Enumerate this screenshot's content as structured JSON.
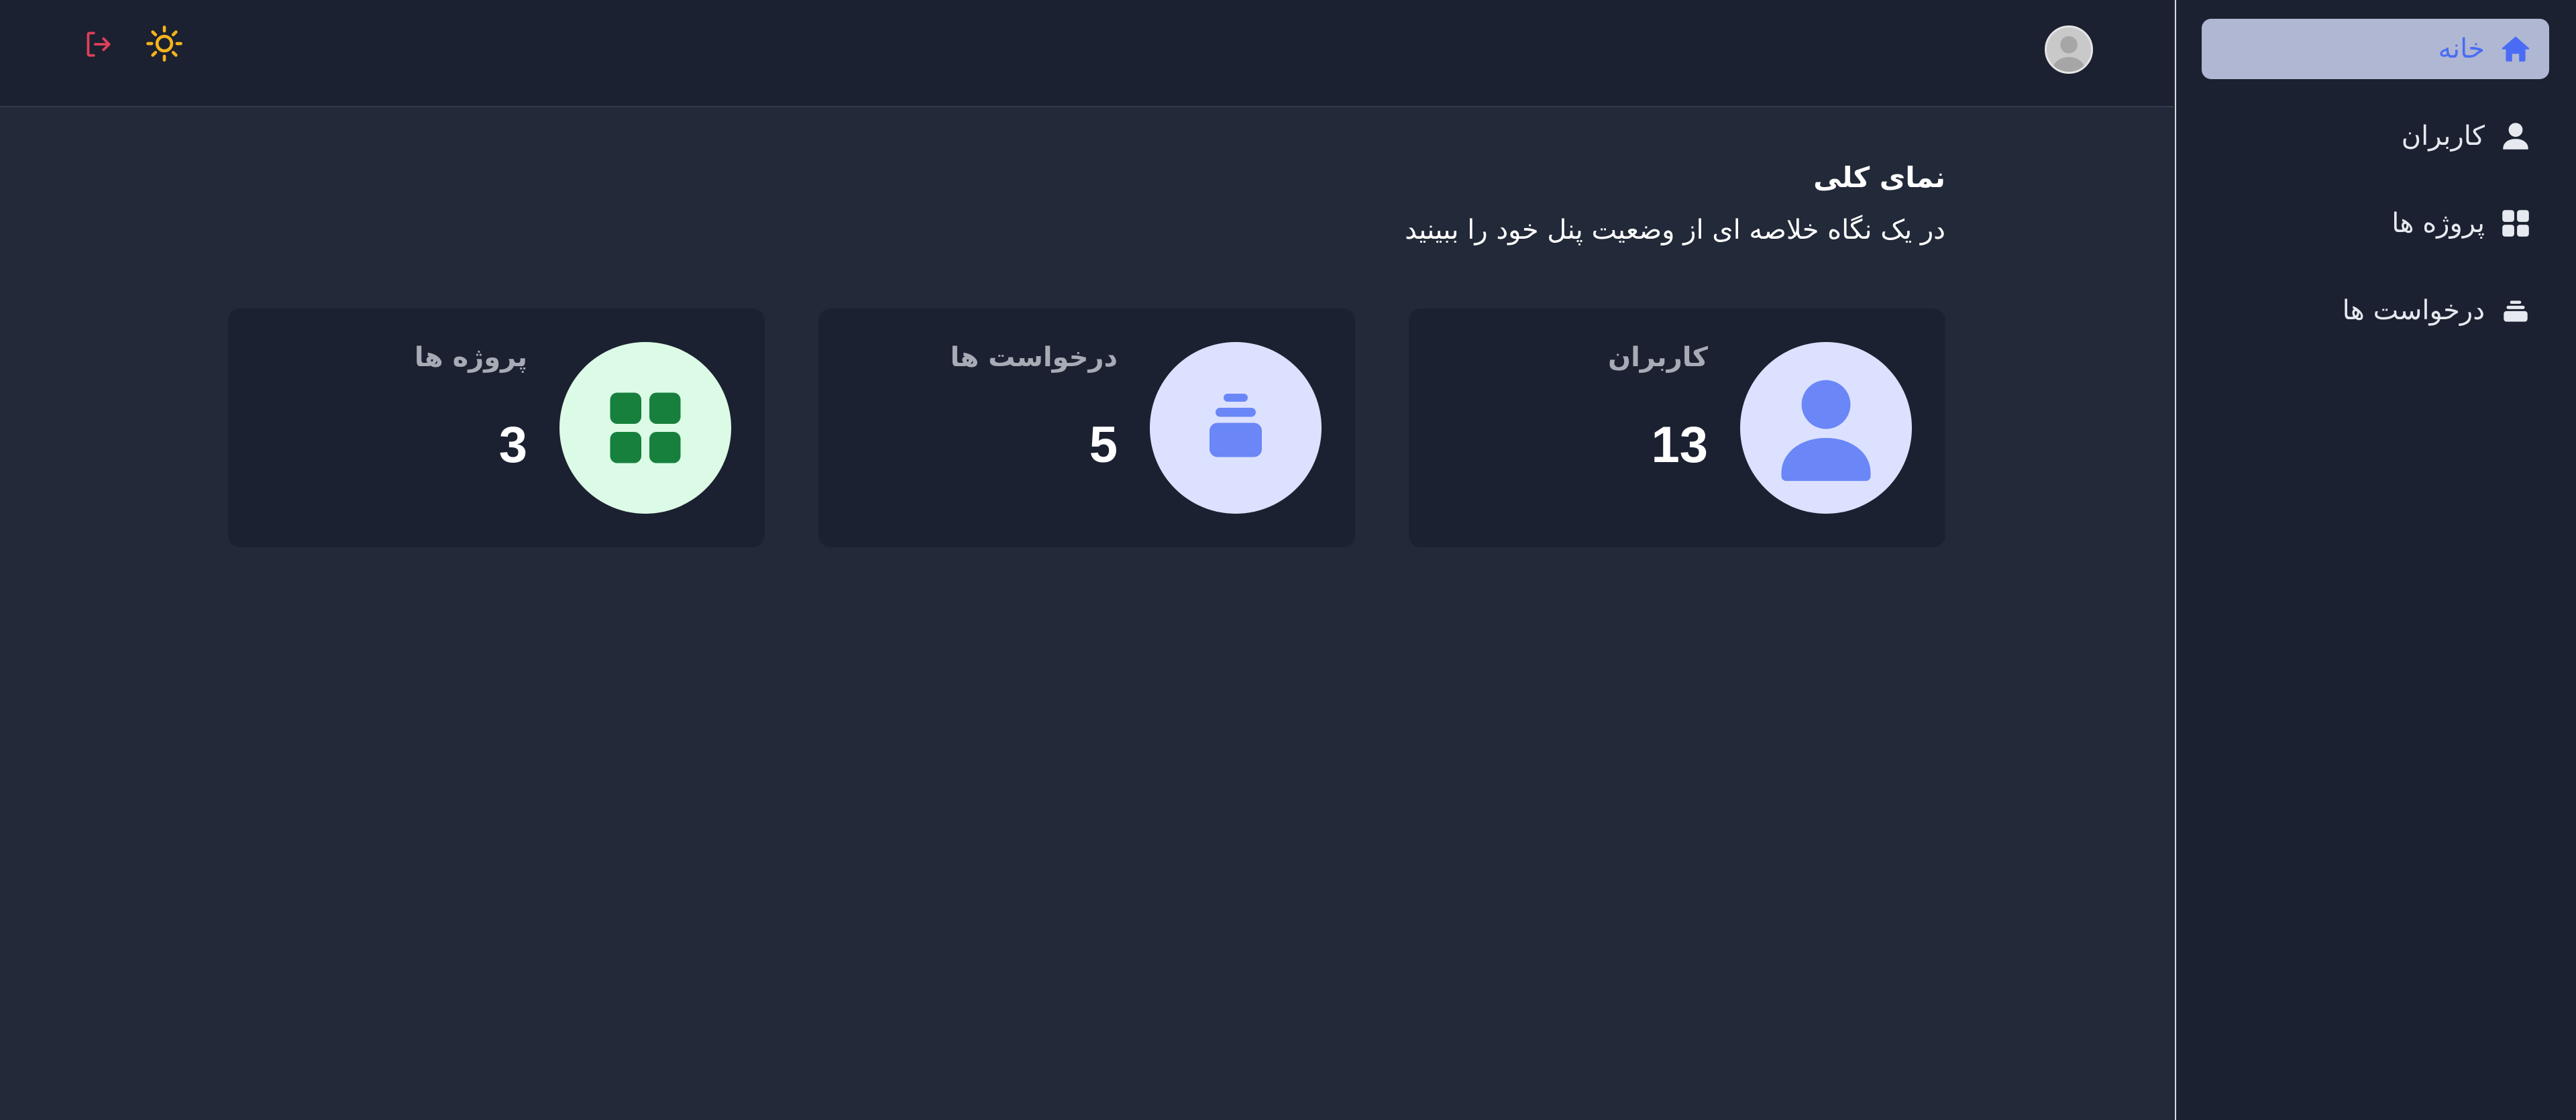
{
  "header": {
    "avatar_label": "",
    "icons": {
      "logout": "logout-icon",
      "theme": "sun-icon",
      "avatar": "user-avatar"
    },
    "colors": {
      "logout": "#e0405a",
      "theme": "#f5b31c"
    }
  },
  "sidebar": {
    "items": [
      {
        "label": "خانه",
        "icon": "home-icon",
        "active": true
      },
      {
        "label": "کاربران",
        "icon": "user-icon",
        "active": false
      },
      {
        "label": "پروژه ها",
        "icon": "grid-icon",
        "active": false
      },
      {
        "label": "درخواست ها",
        "icon": "inbox-icon",
        "active": false
      }
    ],
    "colors": {
      "active_bg": "#b0b7d2",
      "active_text": "#4a6cf5"
    }
  },
  "main": {
    "title": "نمای کلی",
    "subtitle": "در یک نگاه خلاصه ای از وضعیت پنل خود را ببینید",
    "cards": [
      {
        "label": "کاربران",
        "value": "13",
        "icon": "user-icon",
        "circle_color": "#dce1ff",
        "icon_color": "#6a86f7"
      },
      {
        "label": "درخواست ها",
        "value": "5",
        "icon": "inbox-icon",
        "circle_color": "#dce1ff",
        "icon_color": "#6a86f7"
      },
      {
        "label": "پروژه ها",
        "value": "3",
        "icon": "grid-icon",
        "circle_color": "#dcfbe6",
        "icon_color": "#17803d"
      }
    ]
  },
  "theme": {
    "background": "#222938",
    "panel": "#1b2130"
  }
}
